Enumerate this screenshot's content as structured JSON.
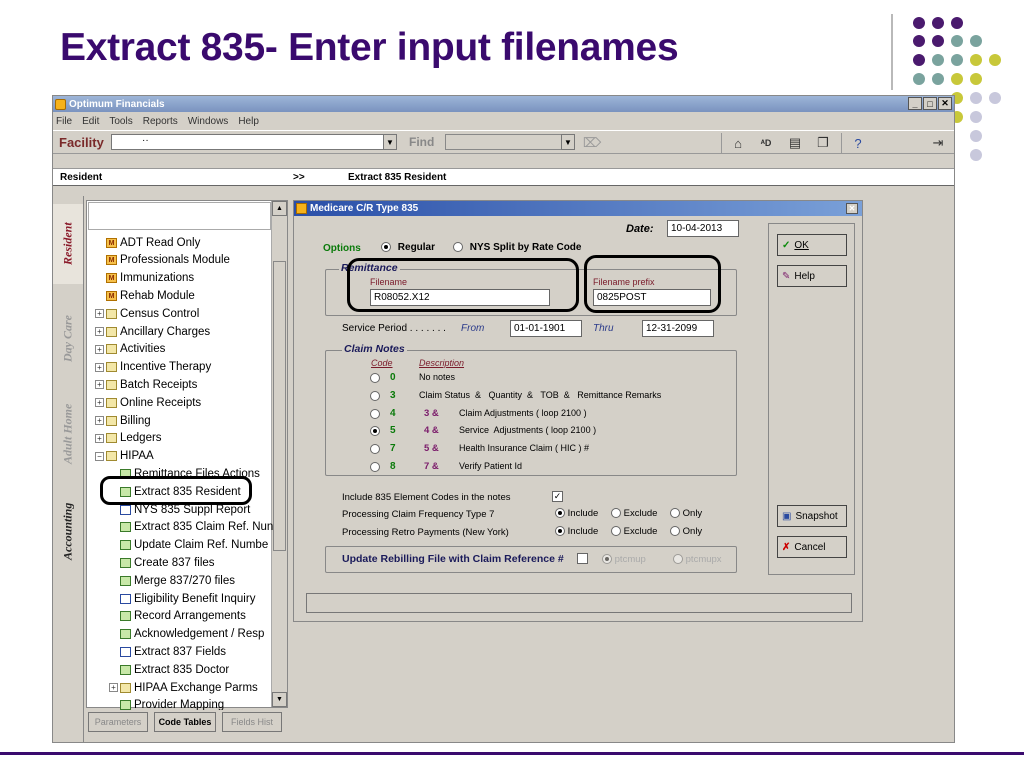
{
  "slide": {
    "title": "Extract 835-  Enter input filenames"
  },
  "app": {
    "window_title": "Optimum Financials",
    "menu": [
      "File",
      "Edit",
      "Tools",
      "Reports",
      "Windows",
      "Help"
    ],
    "facility_label": "Facility",
    "facility_value": "··",
    "find_label": "Find",
    "find_value": "",
    "header_context": "Resident",
    "header_arrow": ">>",
    "header_page": "Extract 835 Resident",
    "side_tabs": [
      "Resident",
      "Day Care",
      "Adult Home",
      "Accounting"
    ],
    "tree_items": [
      {
        "label": "ADT Read Only",
        "icon": "module-icon"
      },
      {
        "label": "Professionals Module",
        "icon": "module-icon"
      },
      {
        "label": "Immunizations",
        "icon": "module-icon"
      },
      {
        "label": "Rehab Module",
        "icon": "module-icon"
      },
      {
        "label": "Census Control",
        "icon": "folder-icon"
      },
      {
        "label": "Ancillary Charges",
        "icon": "folder-icon"
      },
      {
        "label": "Activities",
        "icon": "folder-icon"
      },
      {
        "label": "Incentive Therapy",
        "icon": "folder-icon"
      },
      {
        "label": "Batch Receipts",
        "icon": "folder-icon"
      },
      {
        "label": "Online Receipts",
        "icon": "folder-icon"
      },
      {
        "label": "Billing",
        "icon": "folder-icon"
      },
      {
        "label": "Ledgers",
        "icon": "folder-icon"
      },
      {
        "label": "HIPAA",
        "icon": "open-folder-icon"
      },
      {
        "label": "Remittance Files Actions",
        "icon": "doc-icon"
      },
      {
        "label": "Extract 835 Resident",
        "icon": "doc-icon"
      },
      {
        "label": "NYS 835 Suppl Report",
        "icon": "page-icon"
      },
      {
        "label": "Extract 835 Claim Ref. Nun",
        "icon": "doc-icon"
      },
      {
        "label": "Update Claim Ref. Numbe",
        "icon": "doc-icon"
      },
      {
        "label": "Create 837 files",
        "icon": "doc-icon"
      },
      {
        "label": "Merge 837/270 files",
        "icon": "doc-icon"
      },
      {
        "label": "Eligibility Benefit Inquiry",
        "icon": "page-icon"
      },
      {
        "label": "Record Arrangements",
        "icon": "doc-icon"
      },
      {
        "label": "Acknowledgement / Resp",
        "icon": "doc-icon"
      },
      {
        "label": "Extract 837 Fields",
        "icon": "page-icon"
      },
      {
        "label": "Extract 835 Doctor",
        "icon": "doc-icon"
      },
      {
        "label": "HIPAA Exchange Parms",
        "icon": "folder-icon"
      },
      {
        "label": "Provider Mapping",
        "icon": "doc-icon"
      }
    ],
    "bottom_buttons": [
      "Parameters",
      "Code Tables",
      "Fields Hist"
    ]
  },
  "dialog": {
    "title": "Medicare C/R Type 835",
    "date_label": "Date:",
    "date_value": "10-04-2013",
    "options_label": "Options",
    "opt_regular": "Regular",
    "opt_nys": "NYS Split by Rate Code",
    "remittance_title": "Remittance",
    "filename_label": "Filename",
    "filename_value": "R08052.X12",
    "prefix_label": "Filename  prefix",
    "prefix_value": "0825POST",
    "service_period_label": "Service Period . . . . . . .",
    "from_label": "From",
    "from_value": "01-01-1901",
    "thru_label": "Thru",
    "thru_value": "12-31-2099",
    "claim_notes_title": "Claim Notes",
    "code_header": "Code",
    "desc_header": "Description",
    "claim_codes": [
      {
        "code": "0",
        "prefix": "",
        "desc": "No notes"
      },
      {
        "code": "3",
        "prefix": "",
        "desc": "Claim Status  &   Quantity  &   TOB  &   Remittance Remarks"
      },
      {
        "code": "4",
        "prefix": "3  &",
        "desc": "Claim Adjustments ( loop 2100 )"
      },
      {
        "code": "5",
        "prefix": "4  &",
        "desc": "Service  Adjustments ( loop 2100 )"
      },
      {
        "code": "7",
        "prefix": "5  &",
        "desc": "Health Insurance Claim ( HIC ) #"
      },
      {
        "code": "8",
        "prefix": "7  &",
        "desc": "Verify Patient Id"
      }
    ],
    "include_835_label": "Include 835 Element Codes in the notes",
    "freq7_label": "Processing Claim Frequency Type 7",
    "retro_label": "Processing Retro Payments (New York)",
    "include": "Include",
    "exclude": "Exclude",
    "only": "Only",
    "rebill_label": "Update Rebilling File with Claim Reference #",
    "ptcmup": "ptcmup",
    "ptcmupx": "ptcmupx",
    "ok_label": "OK",
    "help_label": "Help",
    "snapshot_label": "Snapshot",
    "cancel_label": "Cancel"
  },
  "colors": {
    "title": "#3a0a6e",
    "dot_purple": "#4a1a6e",
    "dot_teal": "#7aa39e",
    "dot_yellow": "#c8c83a",
    "dot_lavender": "#c8c8dc"
  }
}
